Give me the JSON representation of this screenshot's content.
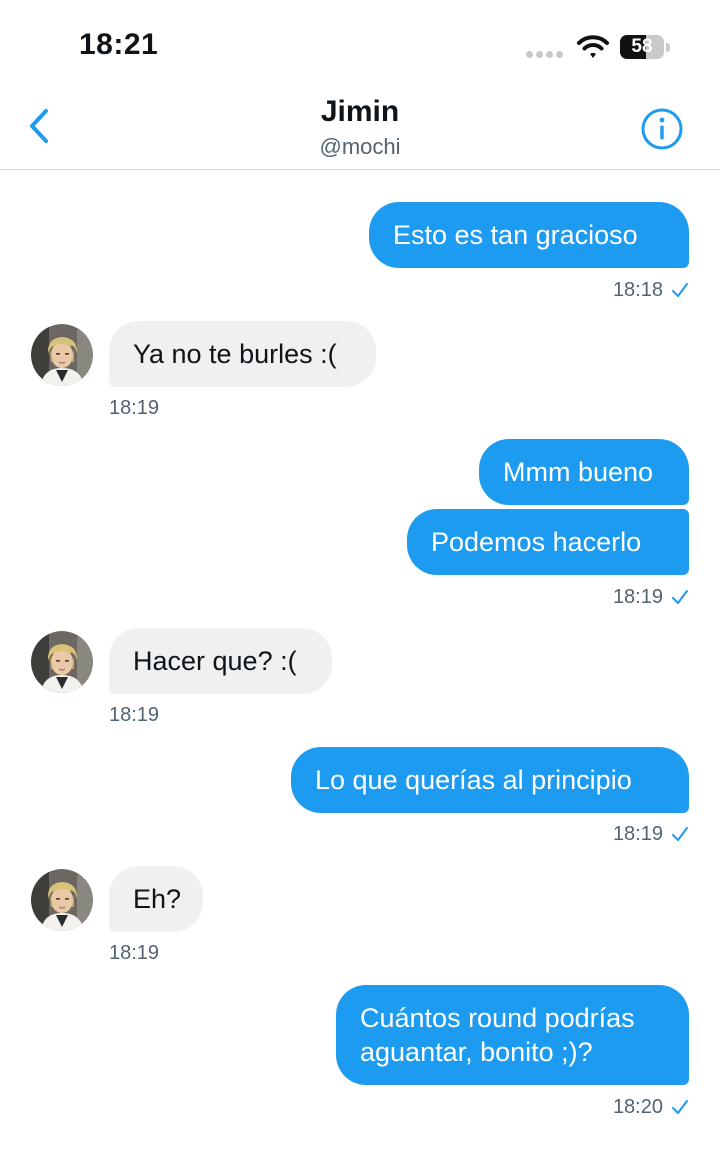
{
  "status_bar": {
    "time": "18:21",
    "battery": "58",
    "battery_level": 0.58
  },
  "header": {
    "name": "Jimin",
    "handle": "@mochi"
  },
  "messages": [
    {
      "direction": "out",
      "text": "Esto es tan gracioso"
    },
    {
      "direction": "out",
      "time": "18:18"
    },
    {
      "direction": "in",
      "text": "Ya no te burles :("
    },
    {
      "direction": "in",
      "time": "18:19"
    },
    {
      "direction": "out",
      "text": "Mmm bueno"
    },
    {
      "direction": "out",
      "text": "Podemos hacerlo"
    },
    {
      "direction": "out",
      "time": "18:19"
    },
    {
      "direction": "in",
      "text": "Hacer que? :("
    },
    {
      "direction": "in",
      "time": "18:19"
    },
    {
      "direction": "out",
      "text": "Lo que querías al principio"
    },
    {
      "direction": "out",
      "time": "18:19"
    },
    {
      "direction": "in",
      "text": "Eh?"
    },
    {
      "direction": "in",
      "time": "18:19"
    },
    {
      "direction": "out",
      "text": "Cuántos round podrías aguantar, bonito ;)?",
      "line1": "Cuántos round podrías",
      "line2": "aguantar, bonito ;)?"
    },
    {
      "direction": "out",
      "time": "18:20"
    }
  ],
  "colors": {
    "accent": "#1d9bf0",
    "incoming_bubble": "#eef0f2",
    "muted_text": "#536471"
  },
  "icons": {
    "back": "chevron-left-icon",
    "info": "info-circle-icon",
    "read": "checkmark-icon"
  }
}
